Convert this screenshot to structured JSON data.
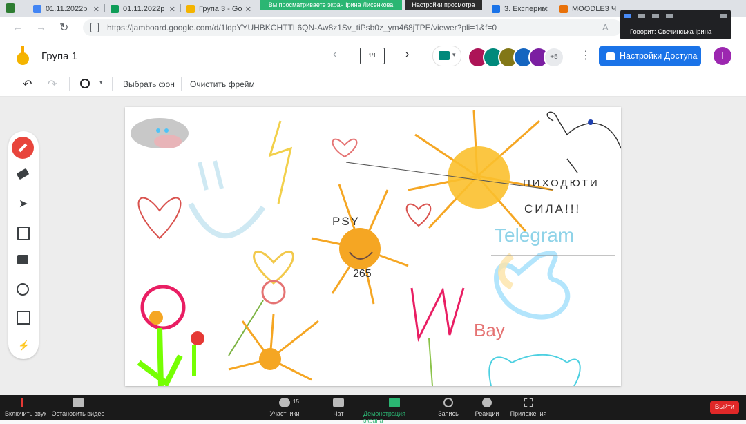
{
  "browser": {
    "tabs": [
      {
        "label": "01.11.2022р",
        "color": "#4285f4"
      },
      {
        "label": "01.11.2022р",
        "color": "#0f9d58"
      },
      {
        "label": "Група 3 - Go",
        "color": "#f4b400"
      },
      {
        "label": "3. Експерим",
        "color": "#1a73e8"
      },
      {
        "label": "MOODLE3 Ч",
        "color": "#e8710a"
      }
    ],
    "url": "https://jamboard.google.com/d/1ldpYYUHBKCHTTL6QN-Aw8z1Sv_tiPsb0z_ym468jTPE/viewer?pli=1&f=0"
  },
  "zoom_overlay": {
    "share_banner": "Вы просматриваете экран Ірина Лисенкова",
    "view_options": "Настройки просмотра",
    "speaker": "Говорит: Свечинська Ірина"
  },
  "header": {
    "title": "Група 1",
    "frame_counter": "1/1",
    "participants_more": "+5",
    "share_button": "Настройки Доступа",
    "user_initial": "I"
  },
  "toolbar": {
    "set_background": "Выбрать фон",
    "clear_frame": "Очистить фрейм"
  },
  "canvas_text": {
    "psy": "PSY",
    "num": "265",
    "telegram": "Telegram",
    "bay": "Bay",
    "phrase1": "ПИХОДЮТИ",
    "phrase2": "СИЛА!!!"
  },
  "zoom_bar": {
    "mute": "Включить звук",
    "video": "Остановить видео",
    "participants": "Участники",
    "participants_count": "15",
    "chat": "Чат",
    "share": "Демонстрация экрана",
    "record": "Запись",
    "reactions": "Реакции",
    "apps": "Приложения",
    "leave": "Выйти"
  },
  "colors": {
    "accent_blue": "#1a73e8",
    "pen_red": "#e8453c",
    "zoom_green": "#2bb673",
    "leave_red": "#e02828",
    "sun_orange": "#f5a623"
  }
}
